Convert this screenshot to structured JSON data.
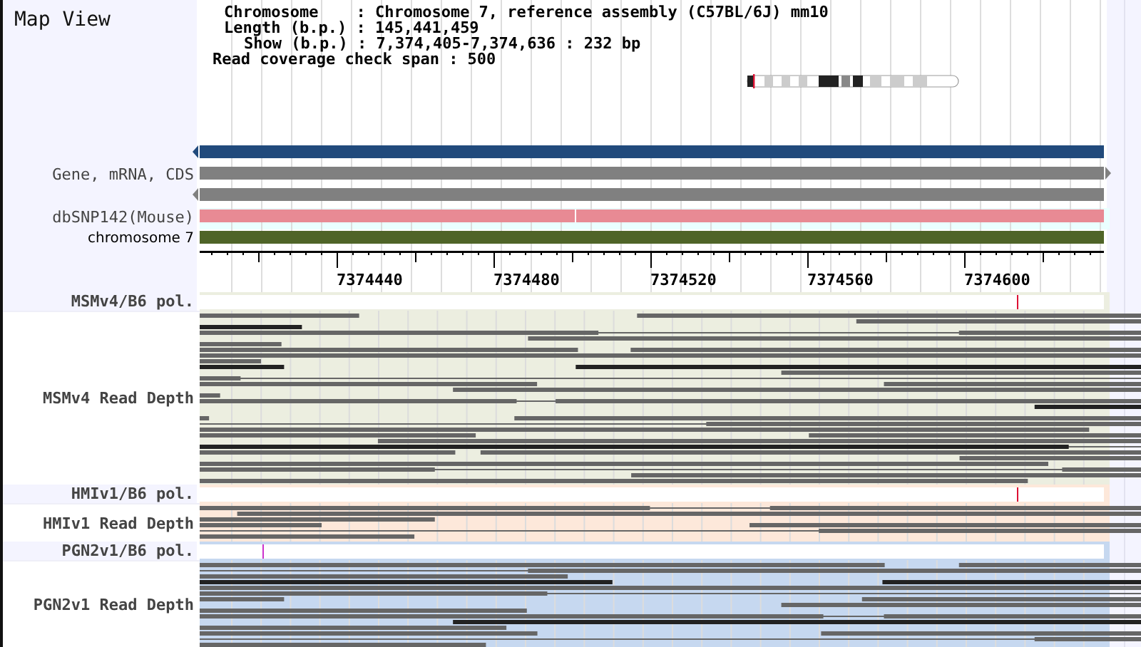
{
  "map_view": {
    "title": "Map View"
  },
  "info": [
    {
      "kind": "normal",
      "text": "Chromosome    : Chromosome 7, reference assembly (C57BL/6J) mm10"
    },
    {
      "kind": "normal",
      "text": "Length (b.p.) : 145,441,459"
    },
    {
      "kind": "indented",
      "text": "Show (b.p.) : 7,374,405-7,374,636 : 232 bp"
    },
    {
      "kind": "outdented",
      "text": "Read coverage check span : 500"
    }
  ],
  "tracks": [
    {
      "kind": "feature",
      "color": "#214a7c",
      "left_arrow": true,
      "right_arrow": false
    },
    {
      "kind": "feature",
      "label": "Gene, mRNA, CDS",
      "color": "#808080",
      "left_arrow": false,
      "right_arrow": true
    },
    {
      "kind": "feature",
      "color": "#808080",
      "left_arrow": true,
      "right_arrow": false
    },
    {
      "kind": "snp",
      "label": "dbSNP142(Mouse)",
      "color": "#e88a94"
    },
    {
      "kind": "chromosome",
      "label": "chromosome 7",
      "color": "#4f6428"
    }
  ],
  "ruler": {
    "labels": [
      "7374440",
      "7374480",
      "7374520",
      "7374560",
      "7374600"
    ]
  },
  "samples": [
    {
      "pol_label": "MSMv4/B6 pol.",
      "depth_label": "MSMv4 Read Depth",
      "color": "#eceee0",
      "marker": {
        "level": 0.903,
        "color": "#dd1133"
      }
    },
    {
      "pol_label": "HMIv1/B6 pol.",
      "depth_label": "HMIv1 Read Depth",
      "color": "#fde8da",
      "marker": {
        "level": 0.903,
        "color": "#dd1133"
      }
    },
    {
      "pol_label": "PGN2v1/B6 pol.",
      "depth_label": "PGN2v1 Read Depth",
      "color": "#c6d8f0",
      "marker": {
        "level": 0.069,
        "color": "#cc33cc"
      }
    }
  ]
}
